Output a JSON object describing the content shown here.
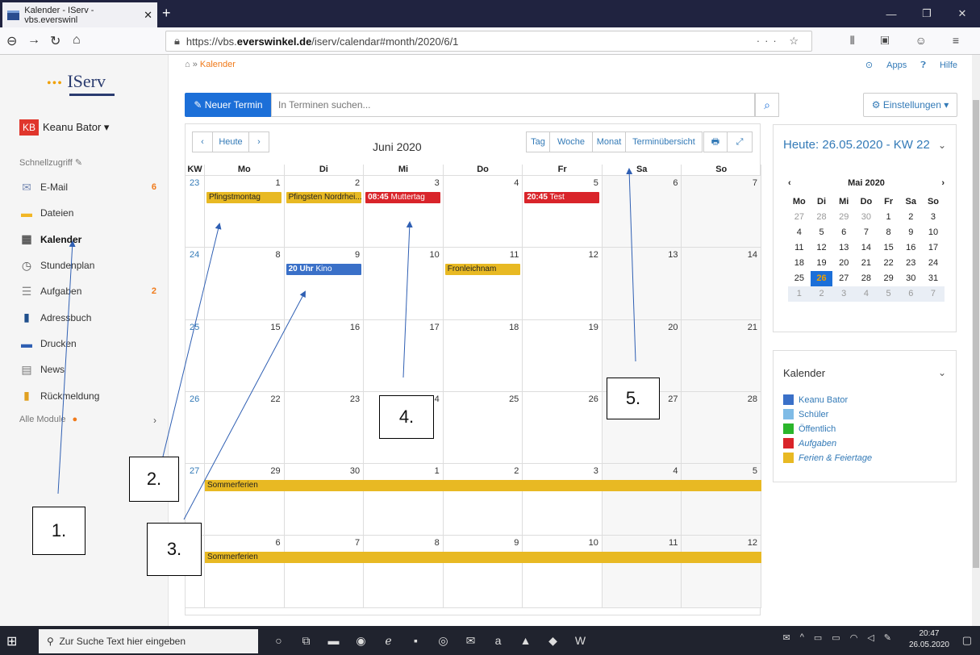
{
  "browser": {
    "tab_title": "Kalender - IServ - vbs.everswinl",
    "url_prefix": "https://vbs.",
    "url_domain": "everswinkel.de",
    "url_path": "/iserv/calendar#month/2020/6/1"
  },
  "app": {
    "logo": "IServ",
    "user_initials": "KB",
    "user_name": "Keanu Bator ▾",
    "schnellzugriff": "Schnellzugriff",
    "menu": [
      {
        "label": "E-Mail",
        "icon": "mail-icon",
        "badge": "6"
      },
      {
        "label": "Dateien",
        "icon": "folder-icon",
        "badge": ""
      },
      {
        "label": "Kalender",
        "icon": "calendar-icon",
        "badge": ""
      },
      {
        "label": "Stundenplan",
        "icon": "clock-icon",
        "badge": ""
      },
      {
        "label": "Aufgaben",
        "icon": "tasks-icon",
        "badge": "2"
      },
      {
        "label": "Adressbuch",
        "icon": "addressbook-icon",
        "badge": ""
      },
      {
        "label": "Drucken",
        "icon": "printer-icon",
        "badge": ""
      },
      {
        "label": "News",
        "icon": "news-icon",
        "badge": ""
      },
      {
        "label": "Rückmeldung",
        "icon": "feedback-icon",
        "badge": ""
      }
    ],
    "alle_module": "Alle Module",
    "breadcrumb_sep": "»",
    "breadcrumb_current": "Kalender",
    "apps_link": "Apps",
    "help_link": "Hilfe"
  },
  "toolbar": {
    "new_event": "Neuer Termin",
    "search_placeholder": "In Terminen suchen...",
    "settings": "Einstellungen ▾"
  },
  "calendar": {
    "today_btn": "Heute",
    "title": "Juni 2020",
    "views": [
      "Tag",
      "Woche",
      "Monat",
      "Terminübersicht"
    ],
    "headers": [
      "KW",
      "Mo",
      "Di",
      "Mi",
      "Do",
      "Fr",
      "Sa",
      "So"
    ],
    "weeks": [
      {
        "kw": "23",
        "days": [
          "1",
          "2",
          "3",
          "4",
          "5",
          "6",
          "7"
        ]
      },
      {
        "kw": "24",
        "days": [
          "8",
          "9",
          "10",
          "11",
          "12",
          "13",
          "14"
        ]
      },
      {
        "kw": "25",
        "days": [
          "15",
          "16",
          "17",
          "18",
          "19",
          "20",
          "21"
        ]
      },
      {
        "kw": "26",
        "days": [
          "22",
          "23",
          "24",
          "25",
          "26",
          "27",
          "28"
        ]
      },
      {
        "kw": "27",
        "days": [
          "29",
          "30",
          "1",
          "2",
          "3",
          "4",
          "5"
        ]
      },
      {
        "kw": "",
        "days": [
          "6",
          "7",
          "8",
          "9",
          "10",
          "11",
          "12"
        ]
      }
    ],
    "events": {
      "pfingstmontag": "Pfingstmontag",
      "pfingsten": "Pfingsten Nordrhei...",
      "muttertag_time": "08:45",
      "muttertag": "Muttertag",
      "test_time": "20:45",
      "test": "Test",
      "kino_time": "20 Uhr",
      "kino": "Kino",
      "fronleichnam": "Fronleichnam",
      "sommerferien": "Sommerferien"
    }
  },
  "today_panel": {
    "title_prefix": "Heute:",
    "title_value": "26.05.2020 - KW 22",
    "month": "Mai 2020",
    "weekdays": [
      "Mo",
      "Di",
      "Mi",
      "Do",
      "Fr",
      "Sa",
      "So"
    ],
    "rows": [
      [
        "27",
        "28",
        "29",
        "30",
        "1",
        "2",
        "3"
      ],
      [
        "4",
        "5",
        "6",
        "7",
        "8",
        "9",
        "10"
      ],
      [
        "11",
        "12",
        "13",
        "14",
        "15",
        "16",
        "17"
      ],
      [
        "18",
        "19",
        "20",
        "21",
        "22",
        "23",
        "24"
      ],
      [
        "25",
        "26",
        "27",
        "28",
        "29",
        "30",
        "31"
      ],
      [
        "1",
        "2",
        "3",
        "4",
        "5",
        "6",
        "7"
      ]
    ]
  },
  "kalender_panel": {
    "title": "Kalender",
    "items": [
      {
        "label": "Keanu Bator",
        "color": "#3a70c8"
      },
      {
        "label": "Schüler",
        "color": "#7fbbe6"
      },
      {
        "label": "Öffentlich",
        "color": "#2bb52b"
      },
      {
        "label": "Aufgaben",
        "color": "#d9242a"
      },
      {
        "label": "Ferien & Feiertage",
        "color": "#e8b923"
      }
    ]
  },
  "annotations": [
    "1.",
    "2.",
    "3.",
    "4.",
    "5."
  ],
  "taskbar": {
    "search": "Zur Suche Text hier eingeben",
    "time": "20:47",
    "date": "26.05.2020"
  }
}
